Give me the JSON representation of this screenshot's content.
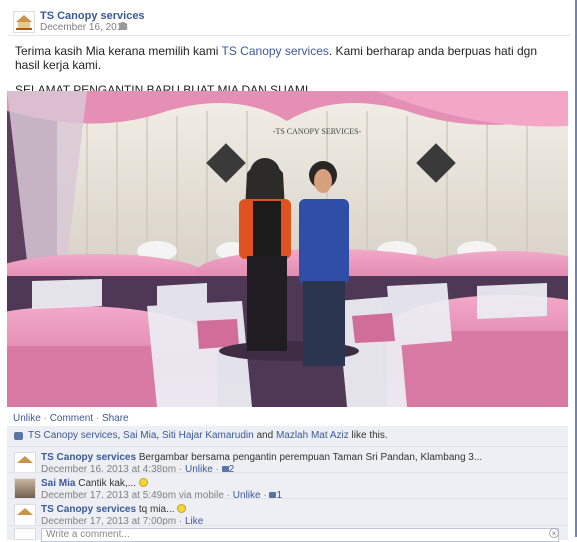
{
  "post": {
    "page_name": "TS Canopy services",
    "date": "December 16, 2013",
    "text_prefix": "Terima kasih Mia kerana memilih kami ",
    "text_link": "TS Canopy services",
    "text_suffix": ". Kami berharap anda berpuas hati dgn hasil kerja kami.",
    "text_line2": "SELAMAT PENGANTIN BARU BUAT MIA DAN SUAMI....",
    "photo_watermark": "-TS CANOPY SERVICES-"
  },
  "actions": {
    "unlike": "Unlike",
    "comment": "Comment",
    "share": "Share"
  },
  "likes": {
    "names": [
      "TS Canopy services",
      "Sai Mia",
      "Siti Hajar Kamarudin"
    ],
    "and_word": "and",
    "last_name": "Mazlah Mat Aziz",
    "suffix": "like this."
  },
  "comments": [
    {
      "author": "TS Canopy services",
      "text": "Bergambar bersama pengantin perempuan Taman Sri Pandan, Klambang 3...",
      "date": "December 16, 2013 at 4:38pm",
      "unlike": "Unlike",
      "likes_count": "2"
    },
    {
      "author": "Sai Mia",
      "text": "Cantik kak,...",
      "date": "December 17, 2013 at 5:49pm via mobile",
      "unlike": "Unlike",
      "likes_count": "1"
    },
    {
      "author": "TS Canopy services",
      "text": "tq mia...",
      "date": "December 17, 2013 at 7:00pm",
      "like": "Like"
    }
  ],
  "write_comment": {
    "placeholder": "Write a comment..."
  },
  "colors": {
    "link": "#3b5998",
    "comment_bg": "#edeff4",
    "drape_pink": "#e58fb5"
  }
}
